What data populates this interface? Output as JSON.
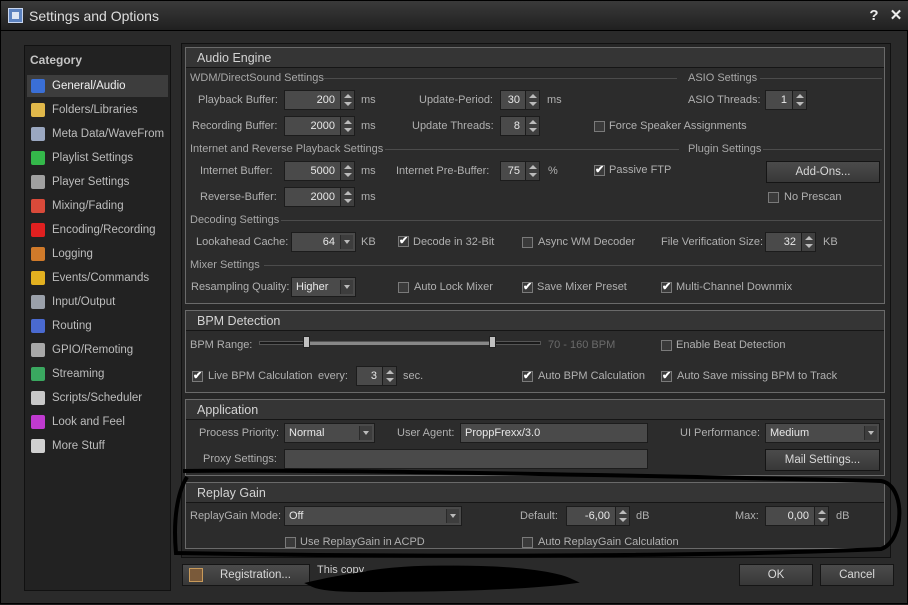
{
  "window": {
    "title": "Settings and Options",
    "help": "?",
    "close": "✕"
  },
  "category": {
    "header": "Category",
    "items": [
      {
        "label": "General/Audio",
        "icon": "music-note-icon",
        "color": "#3a6fd6",
        "selected": true
      },
      {
        "label": "Folders/Libraries",
        "icon": "folder-icon",
        "color": "#e0b84a"
      },
      {
        "label": "Meta Data/WaveFrom",
        "icon": "tag-icon",
        "color": "#9aa7c0"
      },
      {
        "label": "Playlist Settings",
        "icon": "play-icon",
        "color": "#34b84a"
      },
      {
        "label": "Player Settings",
        "icon": "player-icon",
        "color": "#a0a0a0"
      },
      {
        "label": "Mixing/Fading",
        "icon": "crossfade-icon",
        "color": "#d94a3a"
      },
      {
        "label": "Encoding/Recording",
        "icon": "record-icon",
        "color": "#e02020"
      },
      {
        "label": "Logging",
        "icon": "log-book-icon",
        "color": "#d07a2a"
      },
      {
        "label": "Events/Commands",
        "icon": "lightning-icon",
        "color": "#e2b020"
      },
      {
        "label": "Input/Output",
        "icon": "io-icon",
        "color": "#9aa0aa"
      },
      {
        "label": "Routing",
        "icon": "routing-icon",
        "color": "#4a6ad0"
      },
      {
        "label": "GPIO/Remoting",
        "icon": "gpio-icon",
        "color": "#a8a8a8"
      },
      {
        "label": "Streaming",
        "icon": "streaming-icon",
        "color": "#3aa860"
      },
      {
        "label": "Scripts/Scheduler",
        "icon": "clock-icon",
        "color": "#c8c8c8"
      },
      {
        "label": "Look and Feel",
        "icon": "palette-icon",
        "color": "#c03ad0"
      },
      {
        "label": "More Stuff",
        "icon": "more-icon",
        "color": "#d0d0d0"
      }
    ]
  },
  "audio": {
    "title": "Audio Engine",
    "wdm": "WDM/DirectSound Settings",
    "asio": "ASIO Settings",
    "playback_buffer": {
      "label": "Playback Buffer:",
      "value": "200",
      "unit": "ms"
    },
    "recording_buffer": {
      "label": "Recording Buffer:",
      "value": "2000",
      "unit": "ms"
    },
    "update_period": {
      "label": "Update-Period:",
      "value": "30",
      "unit": "ms"
    },
    "update_threads": {
      "label": "Update Threads:",
      "value": "8"
    },
    "asio_threads": {
      "label": "ASIO Threads:",
      "value": "1"
    },
    "force_speaker": {
      "label": "Force Speaker Assignments",
      "checked": false
    },
    "internet_sect": "Internet and Reverse Playback Settings",
    "plugin_sect": "Plugin Settings",
    "internet_buffer": {
      "label": "Internet Buffer:",
      "value": "5000",
      "unit": "ms"
    },
    "reverse_buffer": {
      "label": "Reverse-Buffer:",
      "value": "2000",
      "unit": "ms"
    },
    "internet_prebuffer": {
      "label": "Internet Pre-Buffer:",
      "value": "75",
      "unit": "%"
    },
    "passive_ftp": {
      "label": "Passive FTP",
      "checked": true
    },
    "addons_btn": "Add-Ons...",
    "no_prescan": {
      "label": "No Prescan",
      "checked": false
    },
    "decoding_sect": "Decoding Settings",
    "lookahead": {
      "label": "Lookahead Cache:",
      "value": "64",
      "unit": "KB"
    },
    "decode32": {
      "label": "Decode in 32-Bit",
      "checked": true
    },
    "async_wm": {
      "label": "Async WM Decoder",
      "checked": false
    },
    "file_verif": {
      "label": "File Verification Size:",
      "value": "32",
      "unit": "KB"
    },
    "mixer_sect": "Mixer Settings",
    "resampling": {
      "label": "Resampling Quality:",
      "value": "Higher"
    },
    "auto_lock": {
      "label": "Auto Lock Mixer",
      "checked": false
    },
    "save_preset": {
      "label": "Save Mixer Preset",
      "checked": true
    },
    "multi_downmix": {
      "label": "Multi-Channel Downmix",
      "checked": true
    }
  },
  "bpm": {
    "title": "BPM Detection",
    "range_label": "BPM Range:",
    "range_text": "70 - 160 BPM",
    "range_low": 0.17,
    "range_high": 0.83,
    "enable_beat": {
      "label": "Enable Beat Detection",
      "checked": false
    },
    "live_bpm": {
      "label": "Live BPM Calculation",
      "checked": true
    },
    "every_label": "every:",
    "every_value": "3",
    "every_unit": "sec.",
    "auto_bpm": {
      "label": "Auto BPM Calculation",
      "checked": true
    },
    "auto_save": {
      "label": "Auto Save missing BPM to Track",
      "checked": true
    }
  },
  "application": {
    "title": "Application",
    "priority": {
      "label": "Process Priority:",
      "value": "Normal"
    },
    "user_agent": {
      "label": "User Agent:",
      "value": "ProppFrexx/3.0"
    },
    "ui_perf": {
      "label": "UI Performance:",
      "value": "Medium"
    },
    "proxy": {
      "label": "Proxy Settings:",
      "value": ""
    },
    "mail_btn": "Mail Settings..."
  },
  "replay": {
    "title": "Replay Gain",
    "mode": {
      "label": "ReplayGain Mode:",
      "value": "Off"
    },
    "default": {
      "label": "Default:",
      "value": "-6,00",
      "unit": "dB"
    },
    "max": {
      "label": "Max:",
      "value": "0,00",
      "unit": "dB"
    },
    "use_acpd": {
      "label": "Use ReplayGain in ACPD",
      "checked": false
    },
    "auto_calc": {
      "label": "Auto ReplayGain Calculation",
      "checked": false
    }
  },
  "footer": {
    "registration": "Registration...",
    "notice": "This copy",
    "ok": "OK",
    "cancel": "Cancel"
  }
}
